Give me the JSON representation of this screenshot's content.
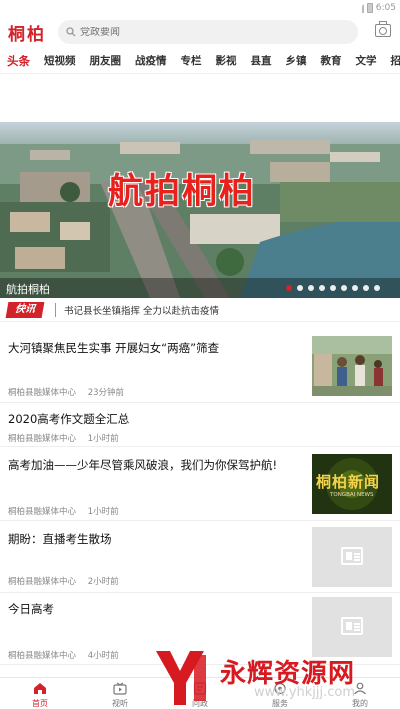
{
  "status_bar": {
    "time": "6:05"
  },
  "header": {
    "logo": "桐柏",
    "search_placeholder": "党政要闻"
  },
  "tabs": [
    "头条",
    "短视频",
    "朋友圈",
    "战疫情",
    "专栏",
    "影视",
    "县直",
    "乡镇",
    "教育",
    "文学",
    "招客"
  ],
  "banner": {
    "overlay_title": "航拍桐柏",
    "caption": "航拍桐柏",
    "slide_count": 9,
    "active_slide": 0
  },
  "flash": {
    "badge": "快讯",
    "text": "书记县长坐镇指挥  全力以赴抗击疫情"
  },
  "news": [
    {
      "title": "大河镇聚焦民生实事    开展妇女“两癌”筛查",
      "source": "桐柏县融媒体中心",
      "time": "23分钟前",
      "thumb": "photo"
    },
    {
      "title": "2020高考作文题全汇总",
      "source": "桐柏县融媒体中心",
      "time": "1小时前",
      "thumb": "none"
    },
    {
      "title": "高考加油——少年尽管乘风破浪，我们为你保驾护航!",
      "source": "桐柏县融媒体中心",
      "time": "1小时前",
      "thumb": "news_logo",
      "thumb_text": "桐柏新闻",
      "thumb_subtext": "TONGBAI NEWS"
    },
    {
      "title": "期盼：直播考生散场",
      "source": "桐柏县融媒体中心",
      "time": "2小时前",
      "thumb": "placeholder"
    },
    {
      "title": "今日高考",
      "source": "桐柏县融媒体中心",
      "time": "4小时前",
      "thumb": "placeholder"
    },
    {
      "title": "",
      "source": "",
      "time": "",
      "thumb": "none"
    }
  ],
  "bottom_nav": [
    {
      "label": "首页",
      "icon": "home-icon",
      "active": true
    },
    {
      "label": "视听",
      "icon": "tv-icon",
      "active": false
    },
    {
      "label": "问政",
      "icon": "question-icon",
      "active": false
    },
    {
      "label": "服务",
      "icon": "service-icon",
      "active": false
    },
    {
      "label": "我的",
      "icon": "user-icon",
      "active": false
    }
  ],
  "watermark": {
    "text": "永辉资源网",
    "url": "www.yhkjjj.com"
  },
  "colors": {
    "brand_red": "#d2232a"
  }
}
